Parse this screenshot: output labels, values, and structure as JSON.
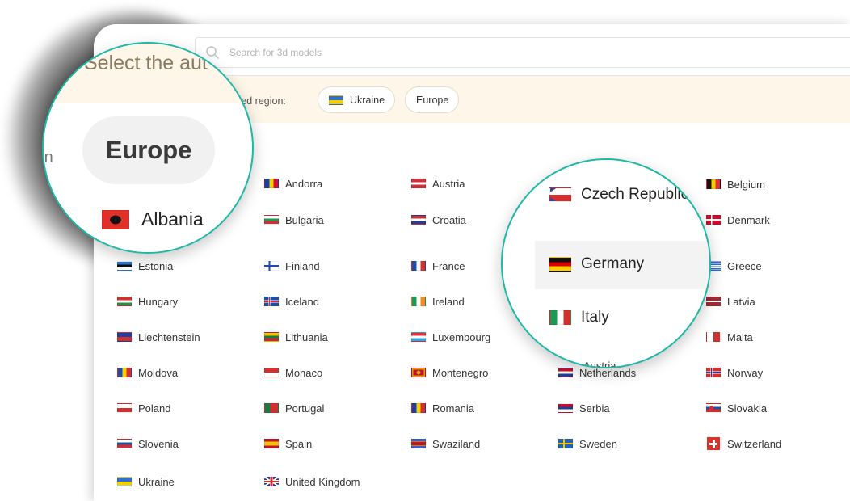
{
  "search": {
    "placeholder": "Search for 3d models"
  },
  "region_bar": {
    "prompt_partial": "rmined region:",
    "chips": [
      {
        "label": "Ukraine",
        "flag": "flag-ukraine"
      },
      {
        "label": "Europe"
      }
    ]
  },
  "magnifier_left": {
    "heading_partial": "Select the aut",
    "pill_label": "Europe",
    "cut_text": "rn",
    "row_label": "Albania"
  },
  "magnifier_right": {
    "items": [
      "Czech Republic",
      "Germany",
      "Italy"
    ],
    "cut_text": "Austria"
  },
  "countries": {
    "col1": [
      "Estonia",
      "Hungary",
      "Liechtenstein",
      "Moldova",
      "Poland",
      "Slovenia",
      "Ukraine"
    ],
    "col2": [
      "Andorra",
      "Bulgaria",
      "Finland",
      "Iceland",
      "Lithuania",
      "Monaco",
      "Portugal",
      "Spain",
      "United Kingdom"
    ],
    "col3": [
      "Austria",
      "Croatia",
      "France",
      "Ireland",
      "Luxembourg",
      "Montenegro",
      "Romania",
      "Swaziland"
    ],
    "col4": [
      "Netherlands",
      "Serbia",
      "Sweden"
    ],
    "col5": [
      "Belgium",
      "Denmark",
      "Greece",
      "Latvia",
      "Malta",
      "Norway",
      "Slovakia",
      "Switzerland"
    ]
  },
  "colors": {
    "accent": "#1fb8a6",
    "region_bg": "#fdf6e9"
  }
}
